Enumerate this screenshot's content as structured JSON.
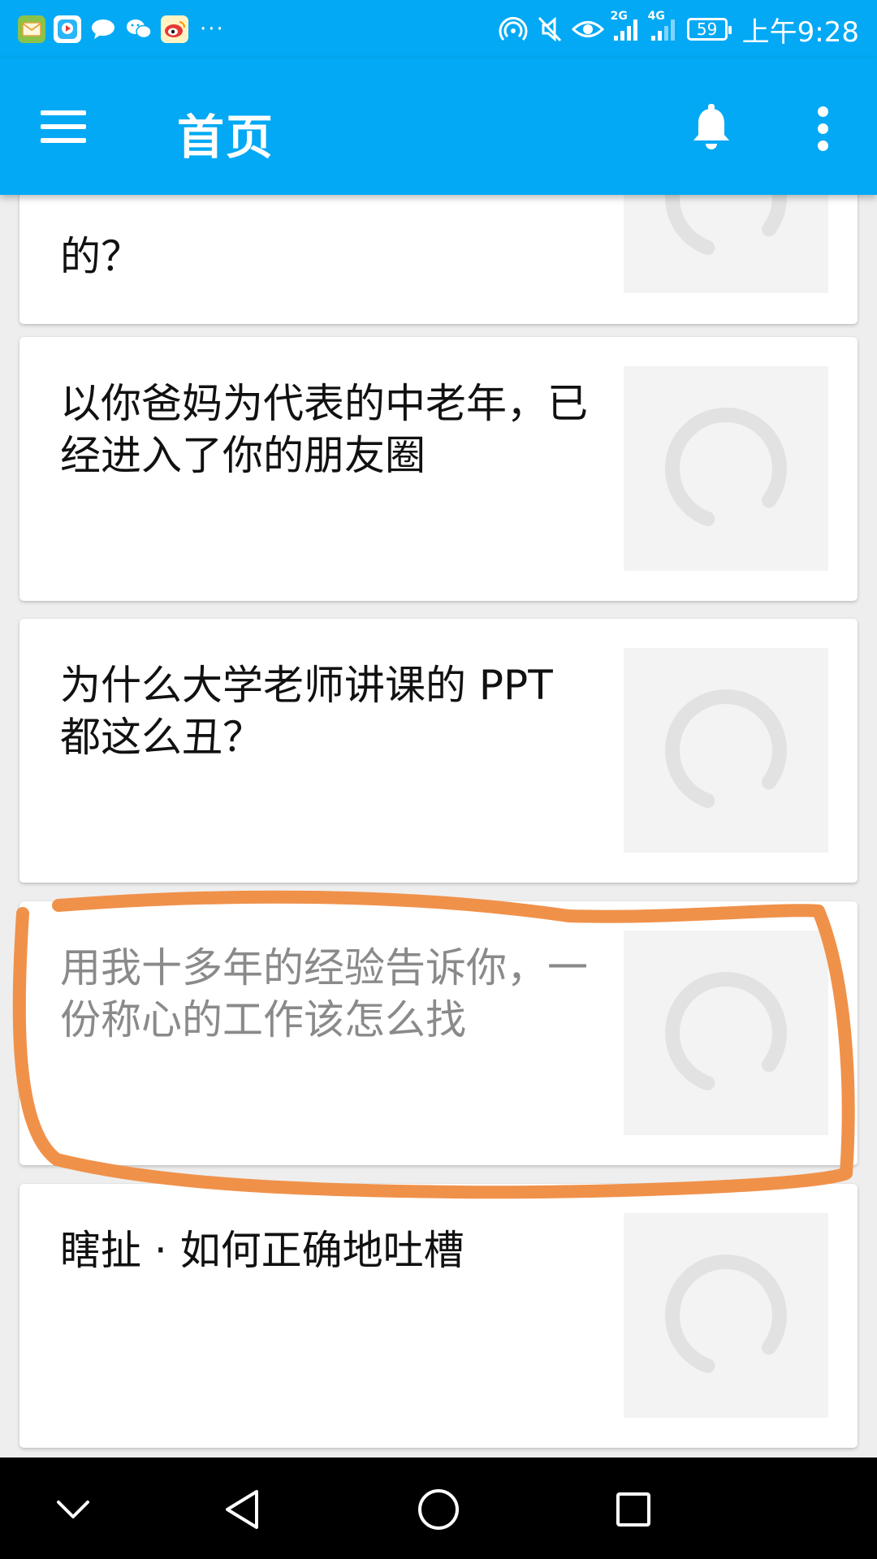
{
  "status_bar": {
    "time": "上午9:28",
    "battery": "59",
    "net1": "2G",
    "net2": "4G",
    "icons": [
      "mail-icon",
      "video-app-icon",
      "message-icon",
      "wechat-icon",
      "weibo-icon",
      "more-dots",
      "hotspot-icon",
      "mute-icon",
      "eye-icon",
      "signal-icon",
      "signal-icon",
      "battery-icon"
    ]
  },
  "app_bar": {
    "title": "首页",
    "icons": [
      "menu-icon",
      "bell-icon",
      "more-vert-icon"
    ]
  },
  "feed": {
    "items": [
      {
        "title": "的？",
        "state": "normal"
      },
      {
        "title": "以你爸妈为代表的中老年，已经进入了你的朋友圈",
        "state": "normal"
      },
      {
        "title": "为什么大学老师讲课的 PPT 都这么丑？",
        "state": "normal"
      },
      {
        "title": "用我十多年的经验告诉你，一份称心的工作该怎么找",
        "state": "read"
      },
      {
        "title": "瞎扯 · 如何正确地吐槽",
        "state": "normal"
      }
    ]
  },
  "annotation": {
    "color": "#f0914a",
    "target_item": 3
  },
  "nav_bar": {
    "icons": [
      "chevron-down-icon",
      "back-icon",
      "home-icon",
      "recents-icon"
    ]
  },
  "colors": {
    "primary": "#03a9f4",
    "read_text": "#8a8a8a"
  }
}
